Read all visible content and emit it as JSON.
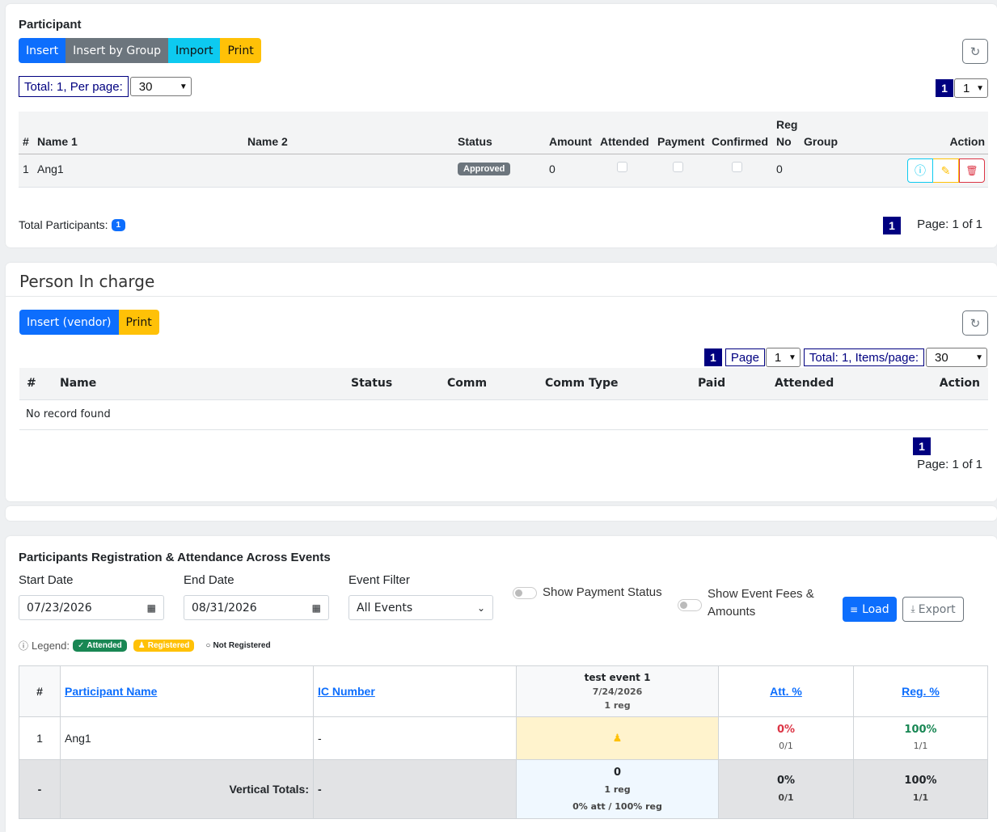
{
  "participant": {
    "title": "Participant",
    "buttons": {
      "insert": "Insert",
      "insert_by_group": "Insert by Group",
      "import": "Import",
      "print": "Print"
    },
    "refresh_icon": "↻",
    "total_per_page_label": "Total: 1, Per page:",
    "per_page_value": "30",
    "page_number": "1",
    "page_select_value": "1",
    "columns": {
      "num": "#",
      "name1": "Name 1",
      "name2": "Name 2",
      "status": "Status",
      "amount": "Amount",
      "attended": "Attended",
      "payment": "Payment",
      "confirmed": "Confirmed",
      "reg_no_top": "Reg",
      "reg_no_bottom": "No",
      "group": "Group",
      "action": "Action"
    },
    "rows": [
      {
        "num": "1",
        "name1": "Ang1",
        "name2": "",
        "status": "Approved",
        "amount": "0",
        "reg_no": "0",
        "group": ""
      }
    ],
    "action_icons": {
      "info": "ⓘ",
      "edit": "✎",
      "delete": "🗑"
    },
    "total_participants_label": "Total Participants:",
    "total_participants_count": "1",
    "footer_page_number": "1",
    "footer_page_text": "Page: 1 of 1"
  },
  "person_in_charge": {
    "title": "Person In charge",
    "buttons": {
      "insert_vendor": "Insert (vendor)",
      "print": "Print"
    },
    "refresh_icon": "↻",
    "page_number": "1",
    "page_label": "Page",
    "page_select_value": "1",
    "total_items_label": "Total: 1, Items/page:",
    "items_per_page_value": "30",
    "columns": {
      "num": "#",
      "name": "Name",
      "status": "Status",
      "comm": "Comm",
      "comm_type": "Comm Type",
      "paid": "Paid",
      "attended": "Attended",
      "action": "Action"
    },
    "empty_text": "No record found",
    "footer_page_number": "1",
    "footer_page_text": "Page: 1 of 1"
  },
  "attendance": {
    "title": "Participants Registration & Attendance Across Events",
    "start_date_label": "Start Date",
    "start_date_value": "07/23/2026",
    "end_date_label": "End Date",
    "end_date_value": "08/31/2026",
    "event_filter_label": "Event Filter",
    "event_filter_value": "All Events",
    "show_payment_status_label": "Show Payment Status",
    "show_event_fees_label_1": "Show Event Fees &",
    "show_event_fees_label_2": "Amounts",
    "load_button": "Load",
    "export_button": "Export",
    "legend_label": "Legend:",
    "legend_attended": "Attended",
    "legend_registered": "Registered",
    "legend_not_registered": "Not Registered",
    "columns": {
      "num": "#",
      "participant_name": "Participant Name",
      "ic_number": "IC Number",
      "att_pct": "Att. %",
      "reg_pct": "Reg. %"
    },
    "event": {
      "name": "test event 1",
      "date": "7/24/2026",
      "reg": "1 reg"
    },
    "rows": [
      {
        "num": "1",
        "name": "Ang1",
        "ic": "-",
        "att_pct": "0%",
        "att_frac": "0/1",
        "reg_pct": "100%",
        "reg_frac": "1/1"
      }
    ],
    "totals": {
      "num": "-",
      "label": "Vertical Totals:",
      "ic": "-",
      "event_count": "0",
      "event_reg": "1 reg",
      "event_summary": "0% att / 100% reg",
      "att_pct": "0%",
      "att_frac": "0/1",
      "reg_pct": "100%",
      "reg_frac": "1/1"
    },
    "colors": {
      "attended": "#198754",
      "registered": "#ffc107",
      "att_red": "#dc3545",
      "reg_green": "#198754"
    }
  }
}
